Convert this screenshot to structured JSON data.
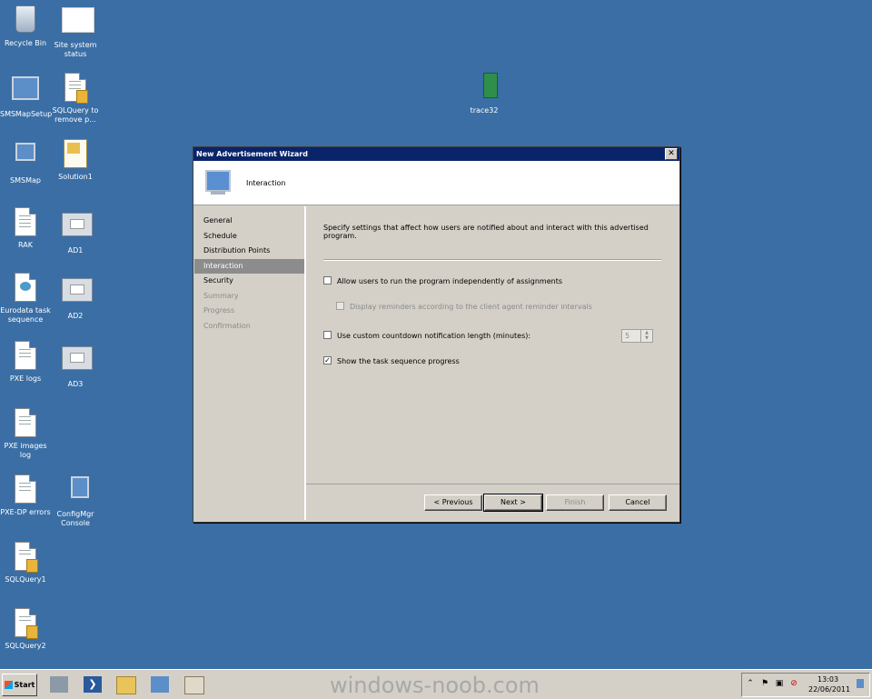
{
  "desktop": {
    "icons": [
      {
        "label": "Recycle Bin",
        "icon": "recycle-bin-icon"
      },
      {
        "label": "Site system status",
        "icon": "blank-window-icon"
      },
      {
        "label": "SMSMapSetup",
        "icon": "setup-icon"
      },
      {
        "label": "SQLQuery to remove p...",
        "icon": "sql-file-icon"
      },
      {
        "label": "SMSMap",
        "icon": "network-map-icon"
      },
      {
        "label": "Solution1",
        "icon": "solution-file-icon"
      },
      {
        "label": "RAK",
        "icon": "document-icon"
      },
      {
        "label": "AD1",
        "icon": "shortcut-window-icon"
      },
      {
        "label": "Eurodata task sequence",
        "icon": "xml-document-icon"
      },
      {
        "label": "AD2",
        "icon": "shortcut-window-icon"
      },
      {
        "label": "PXE logs",
        "icon": "document-icon"
      },
      {
        "label": "AD3",
        "icon": "shortcut-window-icon"
      },
      {
        "label": "PXE images log",
        "icon": "document-icon"
      },
      {
        "label": "PXE-DP errors",
        "icon": "document-icon"
      },
      {
        "label": "ConfigMgr Console",
        "icon": "configmgr-console-icon"
      },
      {
        "label": "SQLQuery1",
        "icon": "sql-file-icon"
      },
      {
        "label": "SQLQuery2",
        "icon": "sql-file-icon"
      },
      {
        "label": "trace32",
        "icon": "trace32-icon"
      }
    ]
  },
  "wizard": {
    "title": "New Advertisement Wizard",
    "close_glyph": "✕",
    "header_title": "Interaction",
    "nav": [
      {
        "label": "General",
        "state": "done"
      },
      {
        "label": "Schedule",
        "state": "done"
      },
      {
        "label": "Distribution Points",
        "state": "done"
      },
      {
        "label": "Interaction",
        "state": "selected"
      },
      {
        "label": "Security",
        "state": "enabled"
      },
      {
        "label": "Summary",
        "state": "disabled"
      },
      {
        "label": "Progress",
        "state": "disabled"
      },
      {
        "label": "Confirmation",
        "state": "disabled"
      }
    ],
    "description": "Specify settings that affect how users are notified about and interact with this advertised program.",
    "options": {
      "allow_independent": {
        "label": "Allow users to run the program independently of assignments",
        "checked": false,
        "enabled": true
      },
      "display_reminders": {
        "label": "Display reminders according to the client agent reminder intervals",
        "checked": false,
        "enabled": false
      },
      "custom_countdown": {
        "label": "Use custom countdown notification length (minutes):",
        "checked": false,
        "enabled": true
      },
      "show_progress": {
        "label": "Show the task sequence progress",
        "checked": true,
        "enabled": true
      }
    },
    "countdown_value": "5",
    "buttons": {
      "previous": "< Previous",
      "next": "Next >",
      "finish": "Finish",
      "cancel": "Cancel"
    }
  },
  "taskbar": {
    "start_label": "Start",
    "watermark": "windows-noob.com",
    "clock_time": "13:03",
    "clock_date": "22/06/2011",
    "tray_icons": [
      "show-hidden-icons-chevron",
      "action-center-flag-icon",
      "network-icon",
      "volume-muted-icon"
    ]
  },
  "colors": {
    "desktop": "#3a6ea5",
    "titlebar": "#0a246a",
    "dialog": "#d4d0c8",
    "nav_selected": "#8c8c8c"
  }
}
